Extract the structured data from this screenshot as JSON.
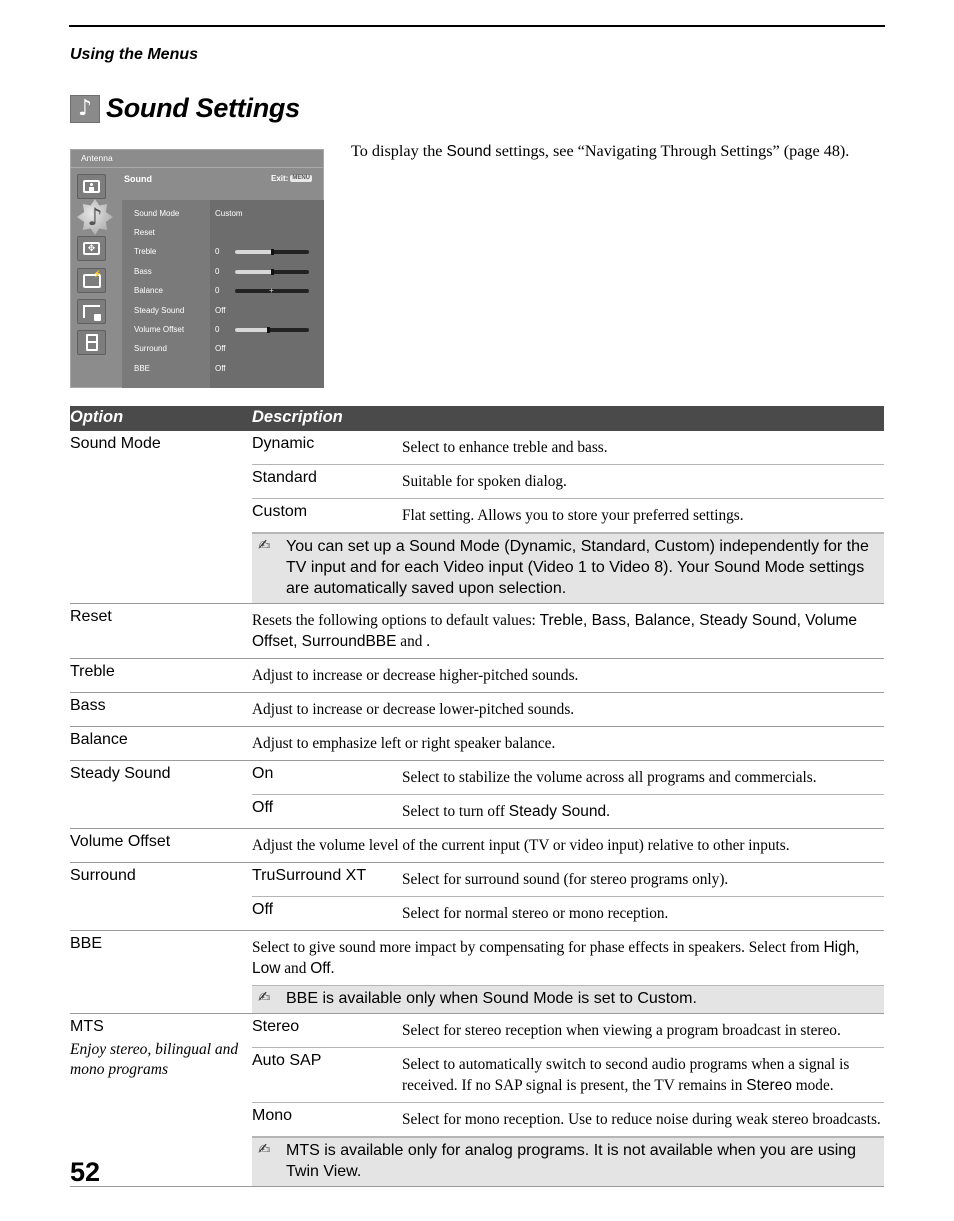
{
  "header": {
    "section_label": "Using the Menus",
    "title_icon": "music-note-icon",
    "title_icon_glyph": "♪",
    "title": "Sound Settings"
  },
  "intro": {
    "before": "To display the ",
    "ui_term": "Sound",
    "after": " settings, see “Navigating Through Settings” (page 48)."
  },
  "tv_menu": {
    "source": "Antenna",
    "header": "Sound",
    "exit_label": "Exit:",
    "exit_key": "MENU",
    "side_icons": [
      "picture-icon",
      "sound-icon",
      "screen-icon",
      "channel-icon",
      "parental-lock-icon",
      "setup-icon"
    ],
    "active_icon_glyph": "♪",
    "items": [
      {
        "label": "Sound Mode",
        "value": "Custom"
      },
      {
        "label": "Reset",
        "value": ""
      },
      {
        "label": "Treble",
        "value": "0",
        "slider": 0.5
      },
      {
        "label": "Bass",
        "value": "0",
        "slider": 0.5
      },
      {
        "label": "Balance",
        "value": "0",
        "slider": 0.5,
        "balance": true
      },
      {
        "label": "Steady Sound",
        "value": "Off"
      },
      {
        "label": "Volume Offset",
        "value": "0",
        "slider": 0.45
      },
      {
        "label": "Surround",
        "value": "Off"
      },
      {
        "label": "BBE",
        "value": "Off"
      }
    ]
  },
  "table": {
    "headers": {
      "option": "Option",
      "description": "Description"
    },
    "note_icon": "✍",
    "rows": [
      {
        "option": "Sound Mode",
        "subs": [
          {
            "name": "Dynamic",
            "text": "Select to enhance treble and bass."
          },
          {
            "name": "Standard",
            "text": "Suitable for spoken dialog."
          },
          {
            "name": "Custom",
            "text": "Flat setting. Allows you to store your preferred settings."
          }
        ],
        "note": "You can set up a Sound Mode (Dynamic, Standard, Custom) independently for the TV input and for each Video input (Video 1 to Video 8). Your Sound Mode settings are automatically saved upon selection."
      },
      {
        "option": "Reset",
        "text_before": "Resets the following options to default values: ",
        "text_ui_1": "Treble, Bass, Balance, Steady Sound, Volume Offset, Surround",
        "text_mid": " and ",
        "text_ui_2": "BBE",
        "text_after": "."
      },
      {
        "option": "Treble",
        "text": "Adjust to increase or decrease higher-pitched sounds."
      },
      {
        "option": "Bass",
        "text": "Adjust to increase or decrease lower-pitched sounds."
      },
      {
        "option": "Balance",
        "text": "Adjust to emphasize left or right speaker balance."
      },
      {
        "option": "Steady Sound",
        "subs": [
          {
            "name": "On",
            "text": "Select to stabilize the volume across all programs and commercials."
          },
          {
            "name": "Off",
            "text_before": "Select to turn off ",
            "text_ui": "Steady Sound",
            "text_after": "."
          }
        ]
      },
      {
        "option": "Volume Offset",
        "text": "Adjust the volume level of the current input (TV or video input) relative to other inputs."
      },
      {
        "option": "Surround",
        "subs": [
          {
            "name": "TruSurround XT",
            "text": "Select for surround sound (for stereo programs only)."
          },
          {
            "name": "Off",
            "text": "Select for normal stereo or mono reception."
          }
        ]
      },
      {
        "option": "BBE",
        "text_before": "Select to give sound more impact by compensating for phase effects in speakers. Select from ",
        "text_ui_1": "High",
        "text_sep": ", ",
        "text_ui_2": "Low",
        "text_mid": " and ",
        "text_ui_3": "Off",
        "text_after": ".",
        "note": "BBE is available only when Sound Mode is set to Custom."
      },
      {
        "option": "MTS",
        "option_sub": "Enjoy stereo, bilingual and mono programs",
        "subs": [
          {
            "name": "Stereo",
            "text": "Select for stereo reception when viewing a program broadcast in stereo."
          },
          {
            "name": "Auto SAP",
            "text_before": "Select to automatically switch to second audio programs when a signal is received. If no SAP signal is present, the TV remains in ",
            "text_ui": "Stereo",
            "text_after": " mode."
          },
          {
            "name": "Mono",
            "text": "Select for mono reception. Use to reduce noise during weak stereo broadcasts."
          }
        ],
        "note": "MTS is available only for analog programs. It is not available when you are using Twin View."
      }
    ]
  },
  "footer": {
    "page_number": "52"
  }
}
